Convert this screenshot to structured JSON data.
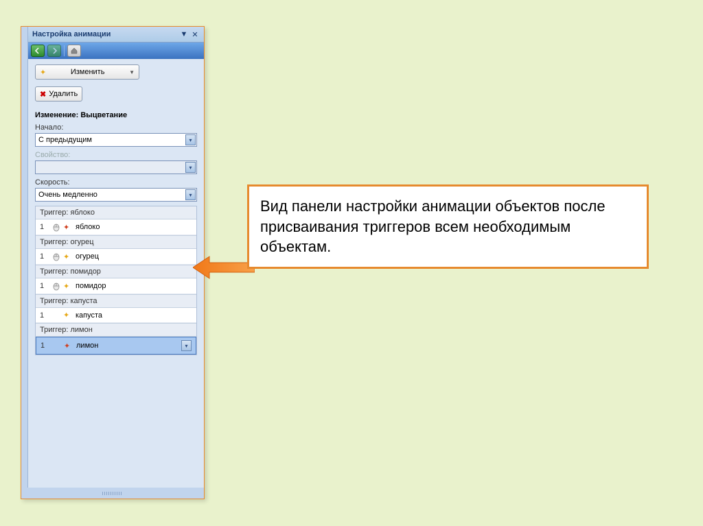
{
  "panel": {
    "title": "Настройка анимации",
    "change_button": "Изменить",
    "delete_button": "Удалить",
    "section_header": "Изменение: Выцветание",
    "start_label": "Начало:",
    "start_value": "С предыдущим",
    "property_label": "Свойство:",
    "speed_label": "Скорость:",
    "speed_value": "Очень медленно"
  },
  "triggers": [
    {
      "header": "Триггер: яблоко",
      "num": "1",
      "name": "яблоко",
      "mouse": true,
      "red": true,
      "selected": false
    },
    {
      "header": "Триггер: огурец",
      "num": "1",
      "name": "огурец",
      "mouse": true,
      "red": false,
      "selected": false
    },
    {
      "header": "Триггер: помидор",
      "num": "1",
      "name": "помидор",
      "mouse": true,
      "red": false,
      "selected": false
    },
    {
      "header": "Триггер: капуста",
      "num": "1",
      "name": "капуста",
      "mouse": false,
      "red": false,
      "selected": false
    },
    {
      "header": "Триггер: лимон",
      "num": "1",
      "name": "лимон",
      "mouse": false,
      "red": true,
      "selected": true
    }
  ],
  "callout": "Вид панели настройки анимации объектов после присваивания триггеров всем необходимым объектам."
}
